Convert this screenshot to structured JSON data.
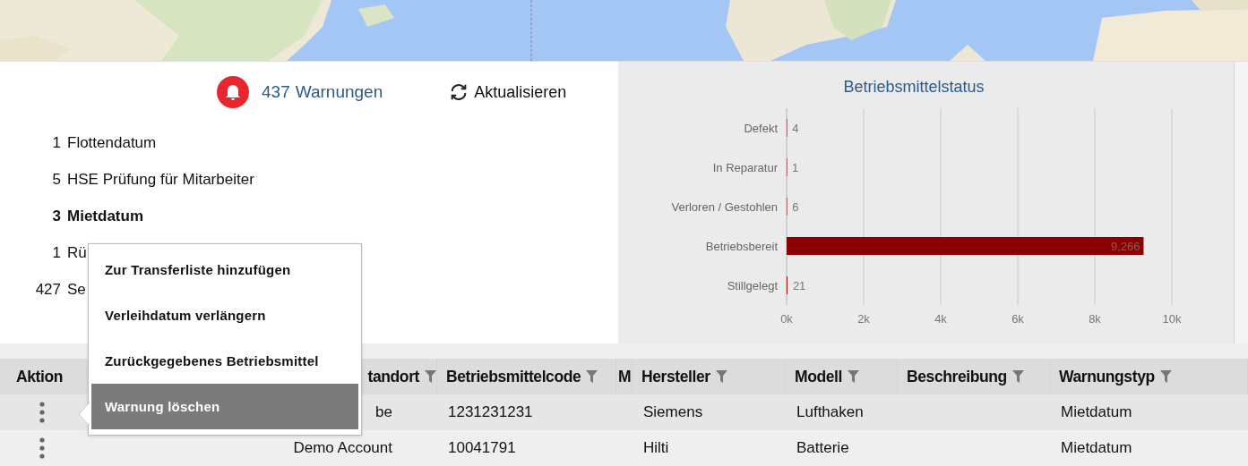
{
  "alerts": {
    "count": "437",
    "label": "Warnungen",
    "refresh": "Aktualisieren",
    "items": [
      {
        "count": "1",
        "label": "Flottendatum",
        "selected": false
      },
      {
        "count": "5",
        "label": "HSE Prüfung für Mitarbeiter",
        "selected": false
      },
      {
        "count": "3",
        "label": "Mietdatum",
        "selected": true
      },
      {
        "count": "1",
        "label": "Rü",
        "selected": false
      },
      {
        "count": "427",
        "label": "Se",
        "selected": false
      }
    ]
  },
  "chart_data": {
    "type": "bar",
    "orientation": "horizontal",
    "title": "Betriebsmittelstatus",
    "categories": [
      "Defekt",
      "In Reparatur",
      "Verloren / Gestohlen",
      "Betriebsbereit",
      "Stillgelegt"
    ],
    "series": [
      {
        "color": "#8b0000",
        "values": [
          4,
          1,
          6,
          9266,
          21
        ]
      }
    ],
    "grid": true,
    "value_labels": [
      "4",
      "1",
      "6",
      "9,266",
      "21"
    ],
    "xlim": [
      0,
      10000
    ],
    "xticks": [
      {
        "value": 0,
        "label": "0k"
      },
      {
        "value": 2000,
        "label": "2k"
      },
      {
        "value": 4000,
        "label": "4k"
      },
      {
        "value": 6000,
        "label": "6k"
      },
      {
        "value": 8000,
        "label": "8k"
      },
      {
        "value": 10000,
        "label": "10k"
      }
    ]
  },
  "table": {
    "columns": [
      {
        "label": "Aktion",
        "filter": false
      },
      {
        "label": "tandort",
        "filter": true
      },
      {
        "label": "Betriebsmittelcode",
        "filter": true
      },
      {
        "label": "M",
        "filter": false
      },
      {
        "label": "Hersteller",
        "filter": true
      },
      {
        "label": "Modell",
        "filter": true
      },
      {
        "label": "Beschreibung",
        "filter": true
      },
      {
        "label": "Warnungstyp",
        "filter": true
      }
    ],
    "rows": [
      {
        "cells": [
          "",
          "be",
          "1231231231",
          "",
          "Siemens",
          "Lufthaken",
          "",
          "Mietdatum"
        ]
      },
      {
        "cells": [
          "",
          "Demo Account",
          "10041791",
          "",
          "Hilti",
          "Batterie",
          "",
          "Mietdatum"
        ]
      }
    ]
  },
  "context_menu": {
    "items": [
      {
        "label": "Zur Transferliste hinzufügen",
        "selected": false
      },
      {
        "label": "Verleihdatum verlängern",
        "selected": false
      },
      {
        "label": "Zurückgegebenes Betriebsmittel",
        "selected": false
      },
      {
        "label": "Warnung löschen",
        "selected": true
      }
    ]
  }
}
